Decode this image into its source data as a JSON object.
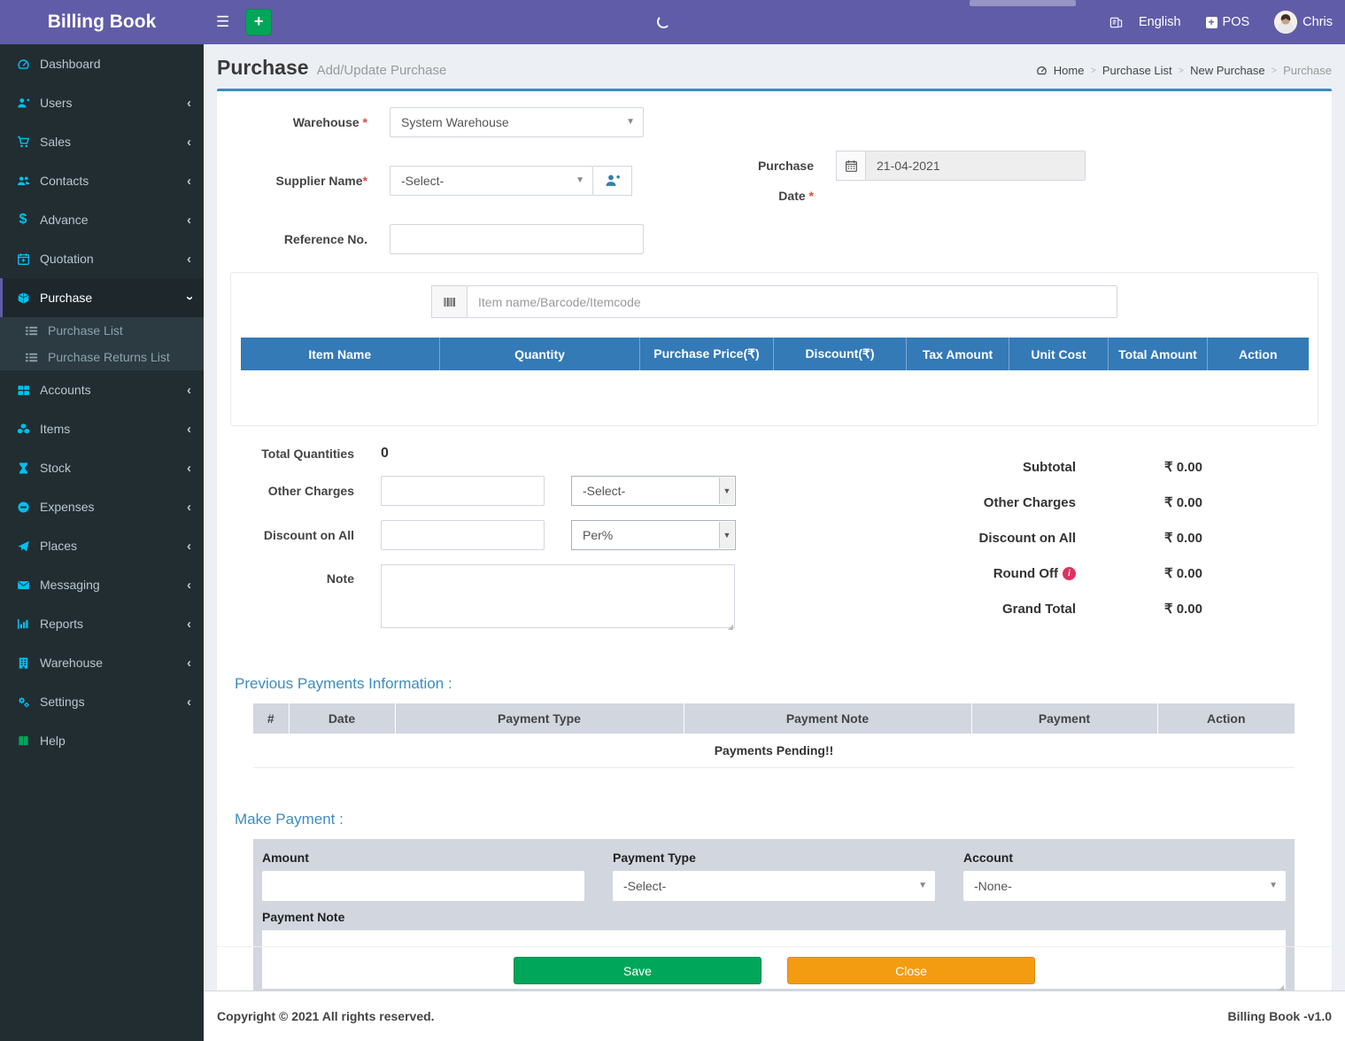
{
  "topbar": {
    "brand": "Billing Book",
    "language_label": "English",
    "pos_label": "POS",
    "user_name": "Chris",
    "add_label": "+"
  },
  "sidebar": {
    "items": [
      {
        "label": "Dashboard",
        "icon": "speedometer-icon"
      },
      {
        "label": "Users",
        "icon": "user-plus-icon"
      },
      {
        "label": "Sales",
        "icon": "cart-icon"
      },
      {
        "label": "Contacts",
        "icon": "users-icon"
      },
      {
        "label": "Advance",
        "icon": "dollar-icon"
      },
      {
        "label": "Quotation",
        "icon": "calendar-plus-icon"
      },
      {
        "label": "Purchase",
        "icon": "cube-icon",
        "active": true,
        "expanded": true
      },
      {
        "label": "Accounts",
        "icon": "grid-icon"
      },
      {
        "label": "Items",
        "icon": "cubes-icon"
      },
      {
        "label": "Stock",
        "icon": "hourglass-icon"
      },
      {
        "label": "Expenses",
        "icon": "minus-circle-icon"
      },
      {
        "label": "Places",
        "icon": "paper-plane-icon"
      },
      {
        "label": "Messaging",
        "icon": "envelope-icon"
      },
      {
        "label": "Reports",
        "icon": "bar-chart-icon"
      },
      {
        "label": "Warehouse",
        "icon": "building-icon"
      },
      {
        "label": "Settings",
        "icon": "gears-icon"
      },
      {
        "label": "Help",
        "icon": "book-icon"
      }
    ],
    "purchase_submenu": [
      {
        "label": "Purchase List",
        "icon": "list-icon"
      },
      {
        "label": "Purchase Returns List",
        "icon": "list-icon"
      }
    ]
  },
  "page_header": {
    "title": "Purchase",
    "subtitle": "Add/Update Purchase",
    "breadcrumb": [
      "Home",
      "Purchase List",
      "New Purchase",
      "Purchase"
    ]
  },
  "form": {
    "warehouse_label": "Warehouse",
    "warehouse_value": "System Warehouse",
    "supplier_label": "Supplier Name",
    "supplier_value": "-Select-",
    "purchase_date_label": "Purchase Date",
    "purchase_date_value": "21-04-2021",
    "reference_label": "Reference No.",
    "required_mark": "*",
    "item_search_placeholder": "Item name/Barcode/Itemcode"
  },
  "item_table": {
    "headers": [
      "Item Name",
      "Quantity",
      "Purchase Price(₹)",
      "Discount(₹)",
      "Tax Amount",
      "Unit Cost",
      "Total Amount",
      "Action"
    ],
    "rows": []
  },
  "totals_left": {
    "total_quantities_label": "Total Quantities",
    "total_quantities_value": "0",
    "other_charges_label": "Other Charges",
    "other_charges_select_value": "-Select-",
    "discount_label": "Discount on All",
    "discount_select_value": "Per%",
    "note_label": "Note"
  },
  "totals_right": {
    "rows": [
      {
        "label": "Subtotal",
        "value": "₹ 0.00"
      },
      {
        "label": "Other Charges",
        "value": "₹ 0.00"
      },
      {
        "label": "Discount on All",
        "value": "₹ 0.00"
      },
      {
        "label": "Round Off",
        "value": "₹ 0.00",
        "info_icon": "i"
      },
      {
        "label": "Grand Total",
        "value": "₹ 0.00"
      }
    ]
  },
  "previous_payments": {
    "heading": "Previous Payments Information :",
    "headers": [
      "#",
      "Date",
      "Payment Type",
      "Payment Note",
      "Payment",
      "Action"
    ],
    "empty_message": "Payments Pending!!"
  },
  "make_payment": {
    "heading": "Make Payment :",
    "amount_label": "Amount",
    "payment_type_label": "Payment Type",
    "payment_type_value": "-Select-",
    "account_label": "Account",
    "account_value": "-None-",
    "payment_note_label": "Payment Note"
  },
  "actions": {
    "save": "Save",
    "close": "Close"
  },
  "footer": {
    "copyright": "Copyright © 2021 All rights reserved.",
    "version": "Billing Book -v1.0"
  },
  "colors": {
    "navbar": "#605ca8",
    "sidebar": "#222d32",
    "accent_blue": "#3c8dbc",
    "table_header_blue": "#337ab7",
    "success_green": "#00a65a",
    "warning_orange": "#f39c12",
    "icon_cyan": "#00c0ef",
    "panel_gray": "#d2d6de",
    "danger_pink": "#e0315f"
  }
}
